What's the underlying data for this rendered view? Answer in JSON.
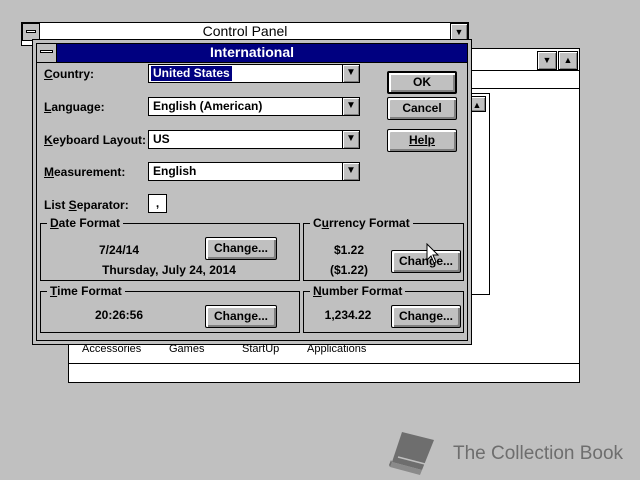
{
  "control_panel": {
    "title": "Control Panel"
  },
  "main_window": {
    "groups": [
      "Accessories",
      "Games",
      "StartUp",
      "Applications"
    ]
  },
  "dialog": {
    "title": "International",
    "fields": {
      "country": {
        "label_pre": "",
        "label_ul": "C",
        "label_post": "ountry:",
        "value": "United States"
      },
      "language": {
        "label_pre": "",
        "label_ul": "L",
        "label_post": "anguage:",
        "value": "English (American)"
      },
      "keyboard": {
        "label_pre": "",
        "label_ul": "K",
        "label_post": "eyboard Layout:",
        "value": "US"
      },
      "measurement": {
        "label_pre": "",
        "label_ul": "M",
        "label_post": "easurement:",
        "value": "English"
      },
      "list_separator": {
        "label_pre": "List ",
        "label_ul": "S",
        "label_post": "eparator:",
        "value": ","
      }
    },
    "buttons": {
      "ok": "OK",
      "cancel": "Cancel",
      "help": "Help"
    },
    "date_format": {
      "title_ul": "D",
      "title_post": "ate Format",
      "short": "7/24/14",
      "long": "Thursday, July 24, 2014",
      "change": "Change..."
    },
    "currency_format": {
      "title_pre": "C",
      "title_ul": "u",
      "title_post": "rrency Format",
      "positive": "$1.22",
      "negative": "($1.22)",
      "change": "Change..."
    },
    "time_format": {
      "title_ul": "T",
      "title_post": "ime Format",
      "value": "20:26:56",
      "change": "Change..."
    },
    "number_format": {
      "title_ul": "N",
      "title_post": "umber Format",
      "value": "1,234.22",
      "change": "Change..."
    }
  },
  "watermark": {
    "text": "The Collection Book",
    "icon": "book-icon"
  },
  "colors": {
    "desktop": "#c0c0c0",
    "active_title": "#000080",
    "selection": "#000080"
  }
}
